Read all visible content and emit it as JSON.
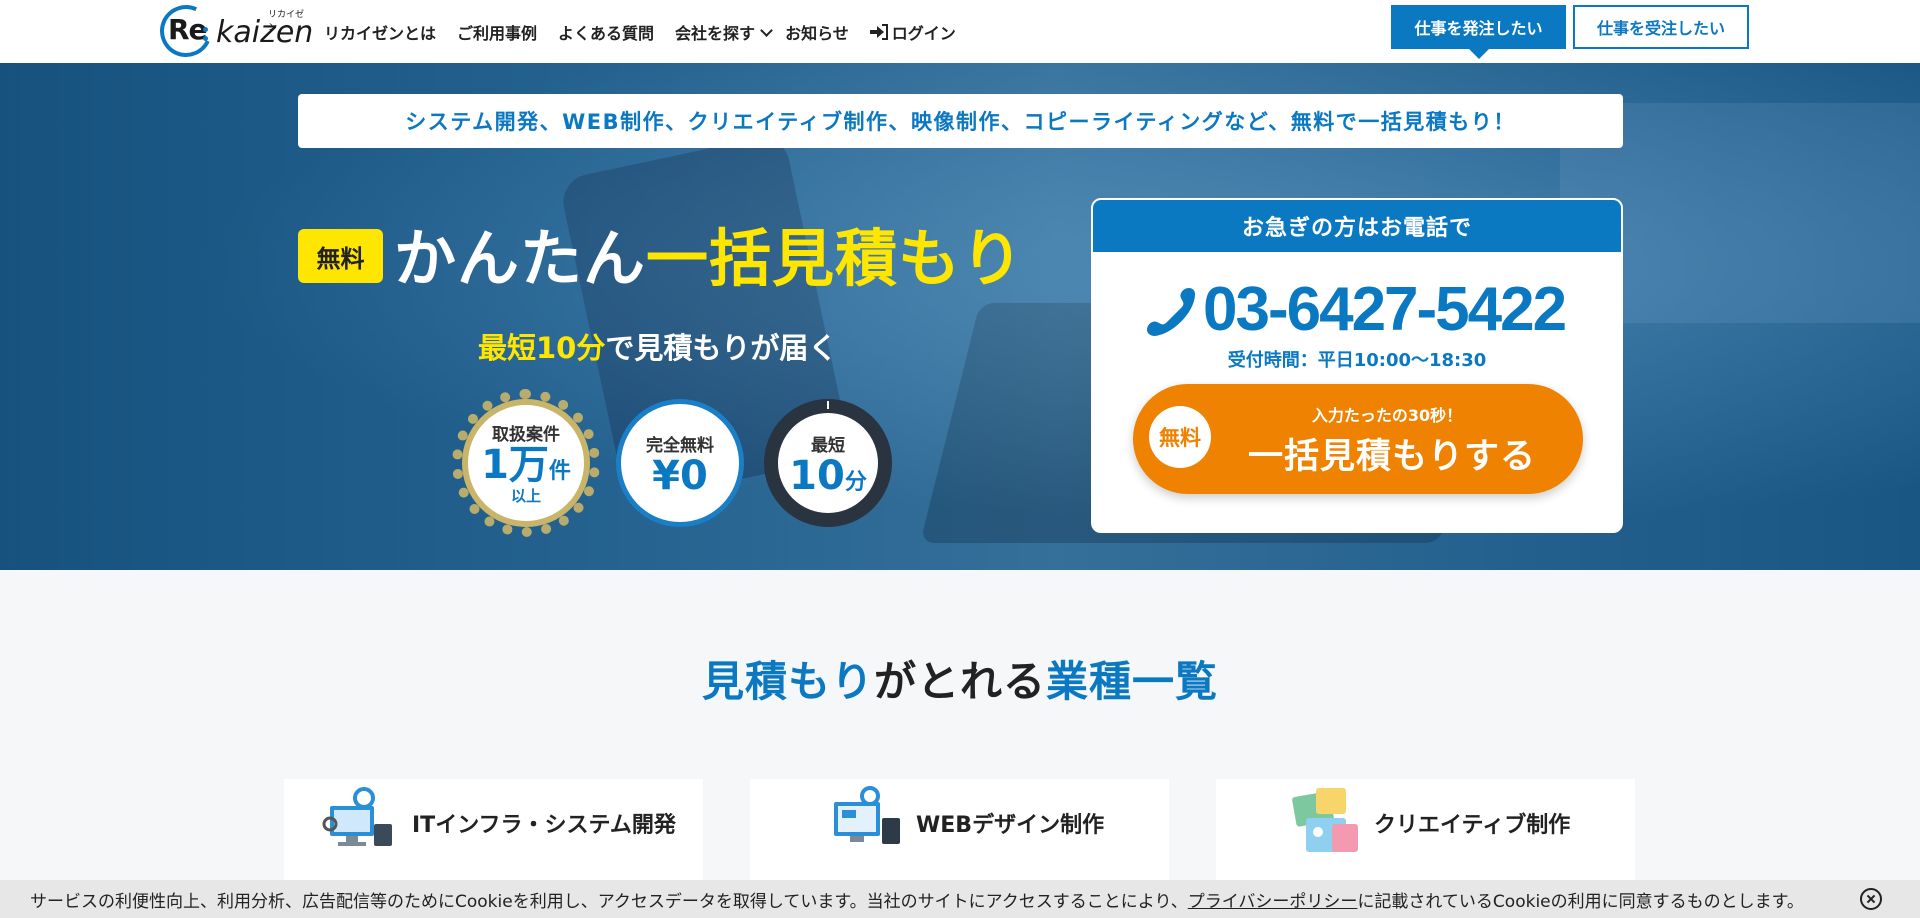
{
  "header": {
    "logo_re": "Re",
    "logo_text": "kaizen",
    "logo_ruby": "リカイゼン",
    "nav": [
      {
        "label": "リカイゼンとは"
      },
      {
        "label": "ご利用事例"
      },
      {
        "label": "よくある質問"
      },
      {
        "label": "会社を探す"
      },
      {
        "label": "お知らせ"
      },
      {
        "label": "ログイン"
      }
    ],
    "order_button": "仕事を発注したい",
    "receive_button": "仕事を受注したい"
  },
  "hero": {
    "banner": "システム開発、WEB制作、クリエイティブ制作、映像制作、コピーライティングなど、無料で一括見積もり！",
    "free_tag": "無料",
    "headline_white": "かんたん",
    "headline_yellow": "一括見積もり",
    "subline_yellow": "最短10分",
    "subline_white": "で見積もりが届く",
    "badges": [
      {
        "top": "取扱案件",
        "big": "1万",
        "unit": "件",
        "bottom": "以上"
      },
      {
        "top": "完全無料",
        "big": "¥0"
      },
      {
        "top": "最短",
        "big": "10",
        "unit": "分"
      }
    ]
  },
  "callbox": {
    "heading": "お急ぎの方はお電話で",
    "phone": "03-6427-5422",
    "hours": "受付時間：平日10:00〜18:30",
    "cta_free": "無料",
    "cta_sub": "入力たったの30秒！",
    "cta_main": "一括見積もりする"
  },
  "section": {
    "title_blue1": "見積もり",
    "title_black": "がとれる",
    "title_blue2": "業種一覧",
    "cards": [
      {
        "title": "ITインフラ・システム開発",
        "icon": "it-system-icon"
      },
      {
        "title": "WEBデザイン制作",
        "icon": "web-design-icon"
      },
      {
        "title": "クリエイティブ制作",
        "icon": "creative-icon"
      }
    ]
  },
  "cookie": {
    "text_before": "サービスの利便性向上、利用分析、広告配信等のためにCookieを利用し、アクセスデータを取得しています。当社のサイトにアクセスすることにより、",
    "link": "プライバシーポリシー",
    "text_after": "に記載されているCookieの利用に同意するものとします。"
  },
  "colors": {
    "brand_blue": "#0b78c2",
    "accent_yellow": "#ffe600",
    "cta_orange": "#ef8200"
  }
}
